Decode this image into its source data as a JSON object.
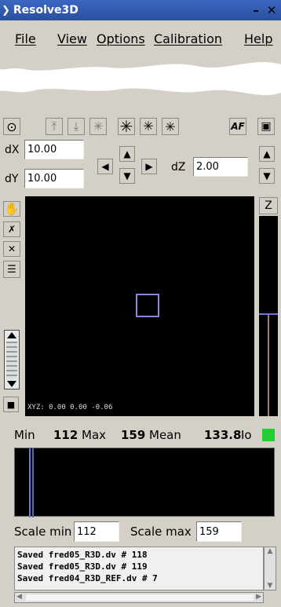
{
  "window": {
    "title": "Resolve3D"
  },
  "menu": [
    "File",
    "View",
    "Options",
    "Calibration",
    "Help"
  ],
  "toolbar": {
    "af_label": "AF"
  },
  "offsets": {
    "dx_label": "dX",
    "dx_value": "10.00",
    "dy_label": "dY",
    "dy_value": "10.00",
    "dz_label": "dZ",
    "dz_value": "2.00"
  },
  "zbar": {
    "label": "Z"
  },
  "viewer": {
    "xyz": "XYZ: 0.00 0.00 -0.06"
  },
  "stats": {
    "min_label": "Min",
    "min_value": "112",
    "max_label": "Max",
    "max_value": "159",
    "mean_label": "Mean",
    "mean_value": "133.8",
    "io_label": "Io",
    "io_color": "#22cc33"
  },
  "scale": {
    "min_label": "Scale min",
    "min_value": "112",
    "max_label": "Scale max",
    "max_value": "159"
  },
  "log": [
    "Saved fred05_R3D.dv # 118",
    "Saved fred05_R3D.dv # 119",
    "Saved fred04_R3D_REF.dv # 7"
  ],
  "icons": [
    "target-icon",
    "focus-up-icon",
    "focus-down-icon",
    "focus-center-icon",
    "star-icon",
    "star-up-icon",
    "star-down-icon",
    "camera-icon",
    "hand-icon",
    "select-icon",
    "cross-icon",
    "list-icon",
    "stop-icon"
  ]
}
